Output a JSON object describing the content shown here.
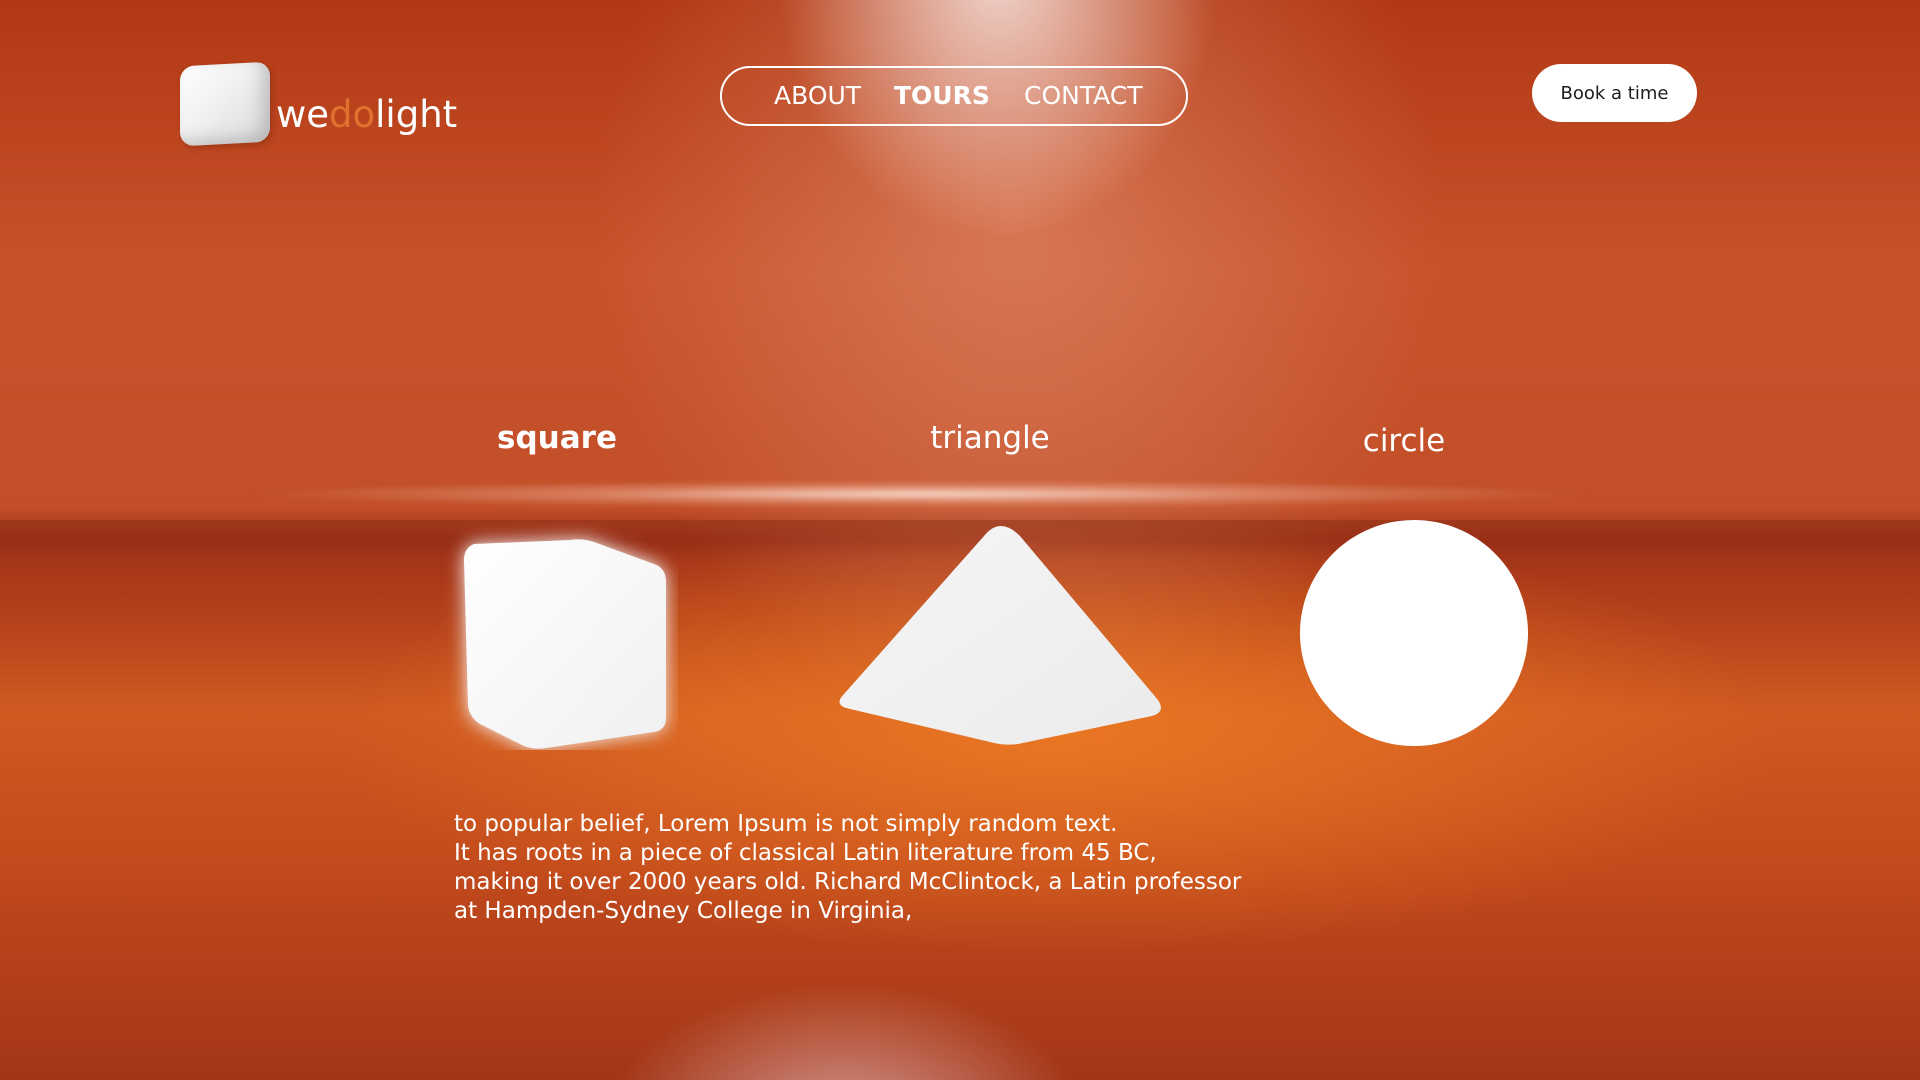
{
  "brand": {
    "logo_parts": [
      "we",
      "do",
      "light"
    ],
    "accent_color": "#e0722f",
    "logo_icon": "cube-icon"
  },
  "nav": {
    "items": [
      {
        "label": "ABOUT",
        "active": false
      },
      {
        "label": "TOURS",
        "active": true
      },
      {
        "label": "CONTACT",
        "active": false
      }
    ]
  },
  "cta": {
    "label": "Book a time"
  },
  "shapes": {
    "items": [
      {
        "label": "square",
        "active": true,
        "icon": "cube-shape"
      },
      {
        "label": "triangle",
        "active": false,
        "icon": "pyramid-shape"
      },
      {
        "label": "circle",
        "active": false,
        "icon": "circle-shape"
      }
    ]
  },
  "body": {
    "lines": [
      "to popular belief, Lorem Ipsum is not simply random text.",
      "It has roots in a piece of classical Latin literature from 45 BC,",
      "making it over 2000 years old. Richard McClintock, a Latin professor",
      "at Hampden-Sydney College in Virginia,"
    ]
  },
  "colors": {
    "background": "#b43c14",
    "glow": "#e0782a",
    "text": "#ffffff"
  }
}
